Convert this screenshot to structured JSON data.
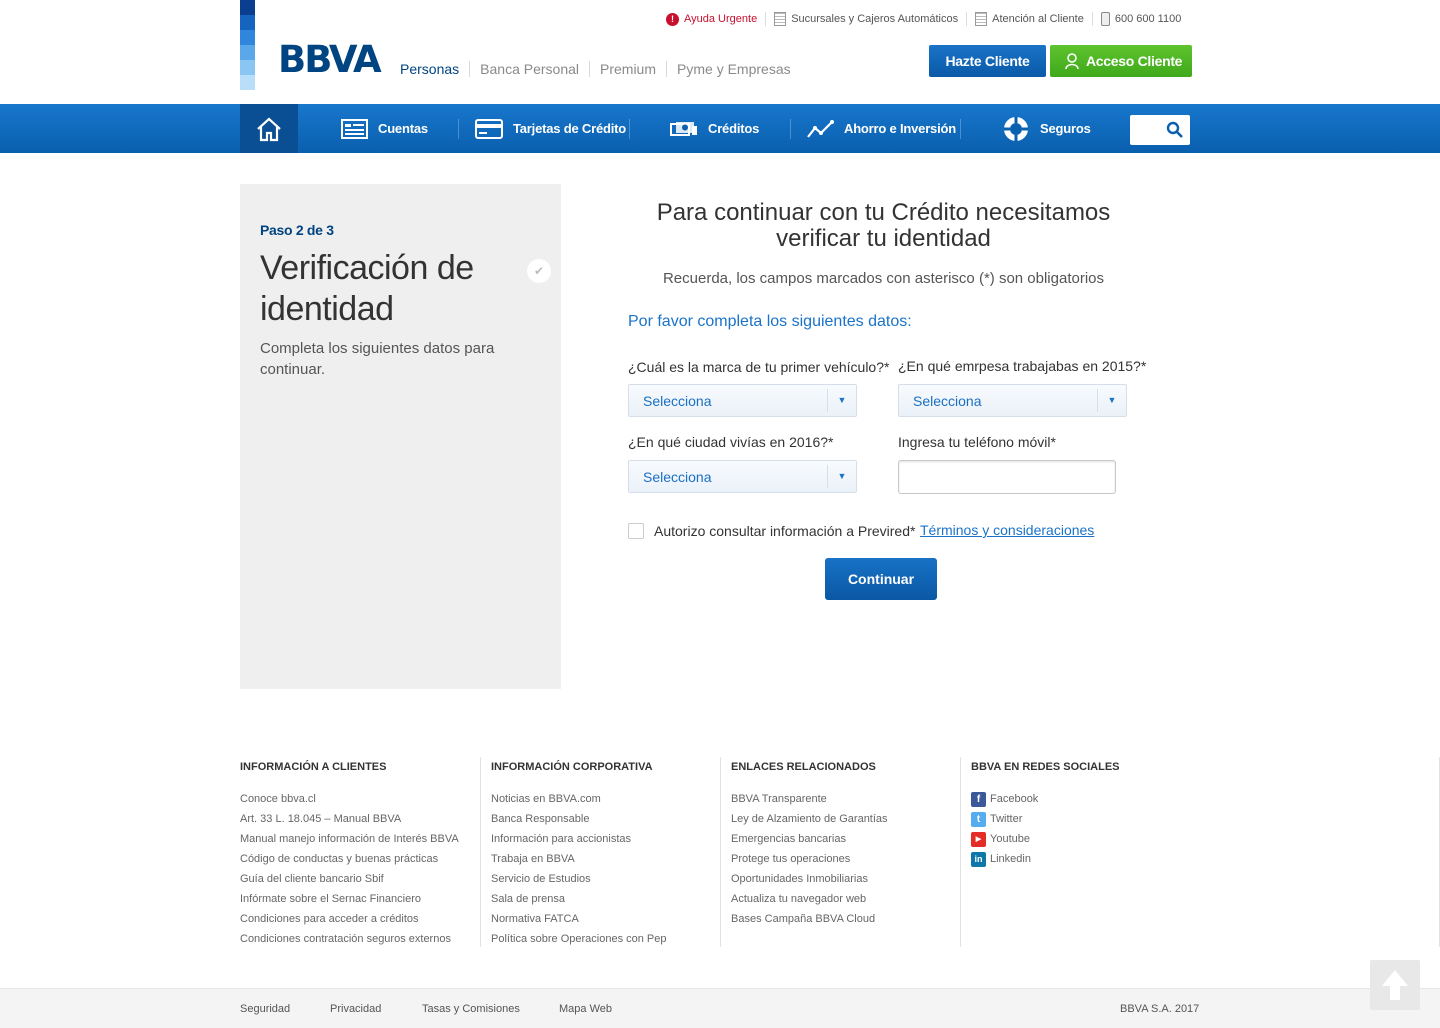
{
  "colors": {
    "brand_blue": "#004481",
    "nav_blue": "#0a5fae",
    "accent_green": "#5ec32e",
    "link_blue": "#1a73c8",
    "alert_red": "#c8102e"
  },
  "brand": {
    "logo_text": "BBVA"
  },
  "segments": [
    "Personas",
    "Banca Personal",
    "Premium",
    "Pyme y Empresas"
  ],
  "toplinks": [
    {
      "label": "Ayuda Urgente",
      "icon": "alert-icon"
    },
    {
      "label": "Sucursales y Cajeros Automáticos",
      "icon": "building-icon"
    },
    {
      "label": "Atención al Cliente",
      "icon": "building-icon"
    },
    {
      "label": "600 600 1100",
      "icon": "phone-icon"
    }
  ],
  "header_buttons": {
    "hazte": "Hazte Cliente",
    "acceso": "Acceso Cliente"
  },
  "nav": {
    "home_icon": "home-icon",
    "items": [
      {
        "label": "Cuentas",
        "icon": "account-icon"
      },
      {
        "label": "Tarjetas de Crédito",
        "icon": "credit-card-icon"
      },
      {
        "label": "Créditos",
        "icon": "money-icon"
      },
      {
        "label": "Ahorro e Inversión",
        "icon": "chart-line-icon"
      },
      {
        "label": "Seguros",
        "icon": "lifebuoy-icon"
      }
    ],
    "search_icon": "search-icon"
  },
  "step": {
    "label": "Paso 2 de 3",
    "title": "Verificación de identidad",
    "description": "Completa los siguientes datos para continuar."
  },
  "form": {
    "title": "Para continuar con tu Crédito necesitamos verificar tu identidad",
    "note": "Recuerda, los campos marcados con asterisco (*) son obligatorios",
    "subtitle": "Por favor completa los siguientes datos:",
    "q1_label": "¿Cuál es la marca de tu primer vehículo?*",
    "q1_value": "Selecciona",
    "q2_label": "¿En qué emrpesa trabajabas en 2015?*",
    "q2_value": "Selecciona",
    "q3_label": "¿En qué ciudad vivías en 2016?*",
    "q3_value": "Selecciona",
    "q4_label": "Ingresa tu teléfono móvil*",
    "q4_value": "",
    "checkbox_label": "Autorizo consultar información a Previred*",
    "terms_link": "Términos y consideraciones",
    "submit": "Continuar"
  },
  "footer": {
    "col1": {
      "heading": "INFORMACIÓN A CLIENTES",
      "links": [
        "Conoce bbva.cl",
        "Art. 33 L. 18.045 – Manual BBVA",
        "Manual manejo información de Interés BBVA",
        "Código de conductas y buenas prácticas",
        "Guía del cliente bancario Sbif",
        "Infórmate sobre el Sernac Financiero",
        "Condiciones para acceder a créditos",
        "Condiciones contratación seguros externos"
      ]
    },
    "col2": {
      "heading": "INFORMACIÓN CORPORATIVA",
      "links": [
        "Noticias en BBVA.com",
        "Banca Responsable",
        "Información para accionistas",
        "Trabaja en BBVA",
        "Servicio de Estudios",
        "Sala de prensa",
        "Normativa FATCA",
        "Política sobre Operaciones con Pep"
      ]
    },
    "col3": {
      "heading": "ENLACES RELACIONADOS",
      "links": [
        "BBVA Transparente",
        "Ley de Alzamiento de Garantías",
        "Emergencias bancarias",
        "Protege tus operaciones",
        "Oportunidades Inmobiliarias",
        "Actualiza tu navegador web",
        "Bases Campaña BBVA Cloud"
      ]
    },
    "col4": {
      "heading": "BBVA EN REDES SOCIALES",
      "links": [
        {
          "label": "Facebook",
          "icon": "facebook-icon",
          "color": "#3b5998",
          "glyph": "f"
        },
        {
          "label": "Twitter",
          "icon": "twitter-icon",
          "color": "#55acee",
          "glyph": "t"
        },
        {
          "label": "Youtube",
          "icon": "youtube-icon",
          "color": "#e52d27",
          "glyph": "▶"
        },
        {
          "label": "Linkedin",
          "icon": "linkedin-icon",
          "color": "#0e76a8",
          "glyph": "in"
        }
      ]
    }
  },
  "bottom": {
    "links": [
      "Seguridad",
      "Privacidad",
      "Tasas y Comisiones",
      "Mapa Web"
    ],
    "copyright": "BBVA S.A. 2017"
  }
}
